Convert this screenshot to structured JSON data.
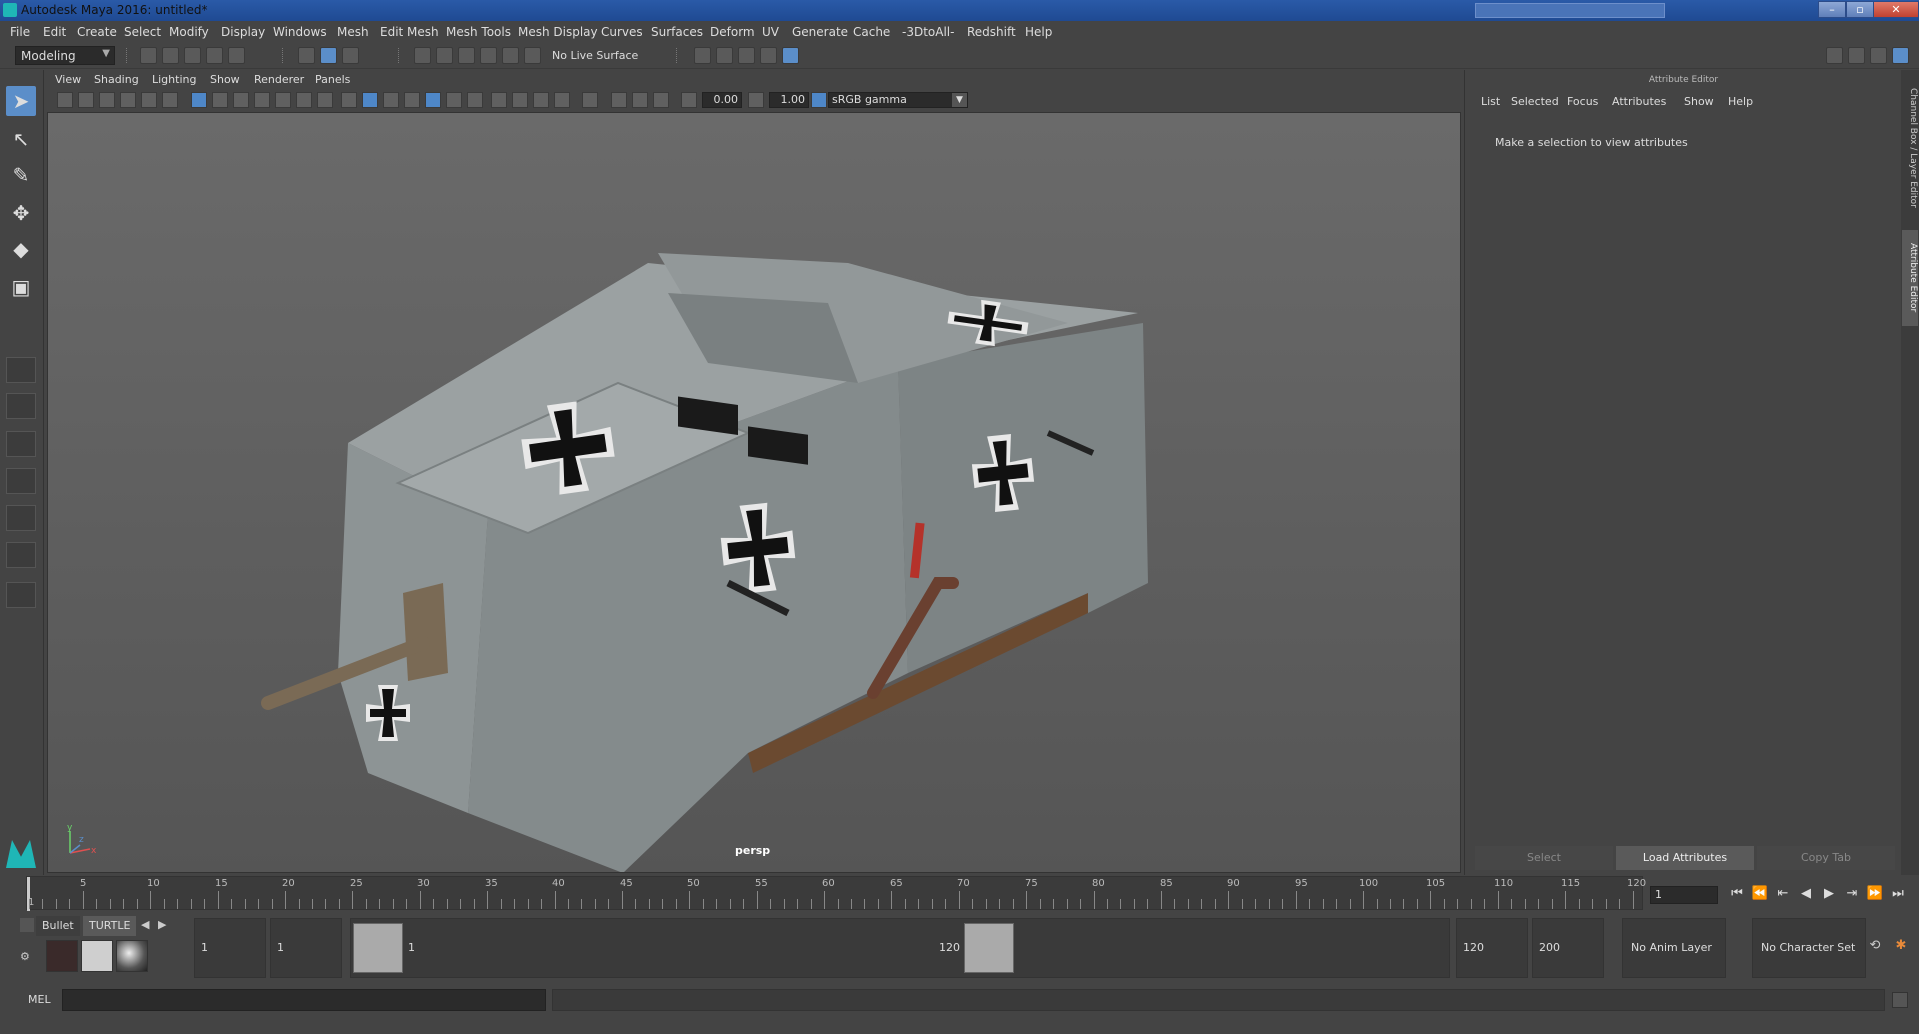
{
  "window": {
    "title": "Autodesk Maya 2016: untitled*",
    "minimize": "–",
    "maximize": "▫",
    "close": "✕"
  },
  "menubar": [
    "File",
    "Edit",
    "Create",
    "Select",
    "Modify",
    "Display",
    "Windows",
    "Mesh",
    "Edit Mesh",
    "Mesh Tools",
    "Mesh Display",
    "Curves",
    "Surfaces",
    "Deform",
    "UV",
    "Generate",
    "Cache",
    "-3DtoAll-",
    "Redshift",
    "Help"
  ],
  "statusline": {
    "menuset": "Modeling",
    "live_surface": "No Live Surface"
  },
  "viewport": {
    "menu": [
      "View",
      "Shading",
      "Lighting",
      "Show",
      "Renderer",
      "Panels"
    ],
    "exposure": "0.00",
    "gamma": "1.00",
    "color_space": "sRGB gamma",
    "camera_label": "persp",
    "axis_labels": {
      "x": "x",
      "y": "y",
      "z": "z"
    }
  },
  "attribute_editor": {
    "header": "Attribute Editor",
    "menu": [
      "List",
      "Selected",
      "Focus",
      "Attributes",
      "Show",
      "Help"
    ],
    "message": "Make a selection to view attributes",
    "buttons": {
      "select": "Select",
      "load": "Load Attributes",
      "copy": "Copy Tab"
    },
    "side_tabs": [
      "Channel Box / Layer Editor",
      "Attribute Editor"
    ]
  },
  "timeslider": {
    "tick_labels": [
      "1",
      "5",
      "10",
      "15",
      "20",
      "25",
      "30",
      "35",
      "40",
      "45",
      "50",
      "55",
      "60",
      "65",
      "70",
      "75",
      "80",
      "85",
      "90",
      "95",
      "100",
      "105",
      "110",
      "115",
      "120"
    ],
    "current_frame": "1"
  },
  "shelf": {
    "tabs": [
      "Bullet",
      "TURTLE"
    ]
  },
  "range": {
    "start": "1",
    "playback_start": "1",
    "handle_start": "1",
    "handle_end": "120",
    "playback_end": "120",
    "end": "200",
    "anim_layer": "No Anim Layer",
    "character_set": "No Character Set"
  },
  "cmdline": {
    "label": "MEL"
  },
  "colors": {
    "accent": "#5b8ec9",
    "title_bar": "#1f4a93",
    "panel_bg": "#444444",
    "tank_body": "#8b9394",
    "cross_black": "#111111",
    "cross_white": "#e8e8e8",
    "numeral_red": "#b5322a",
    "gun_barrel": "#7a6a55",
    "pipe": "#6a4030"
  },
  "icons": {
    "select_tool": "arrow-icon",
    "lasso_tool": "lasso-icon",
    "paint_tool": "brush-icon",
    "move_tool": "move-icon",
    "rotate_tool": "rotate-icon",
    "scale_tool": "scale-icon"
  }
}
